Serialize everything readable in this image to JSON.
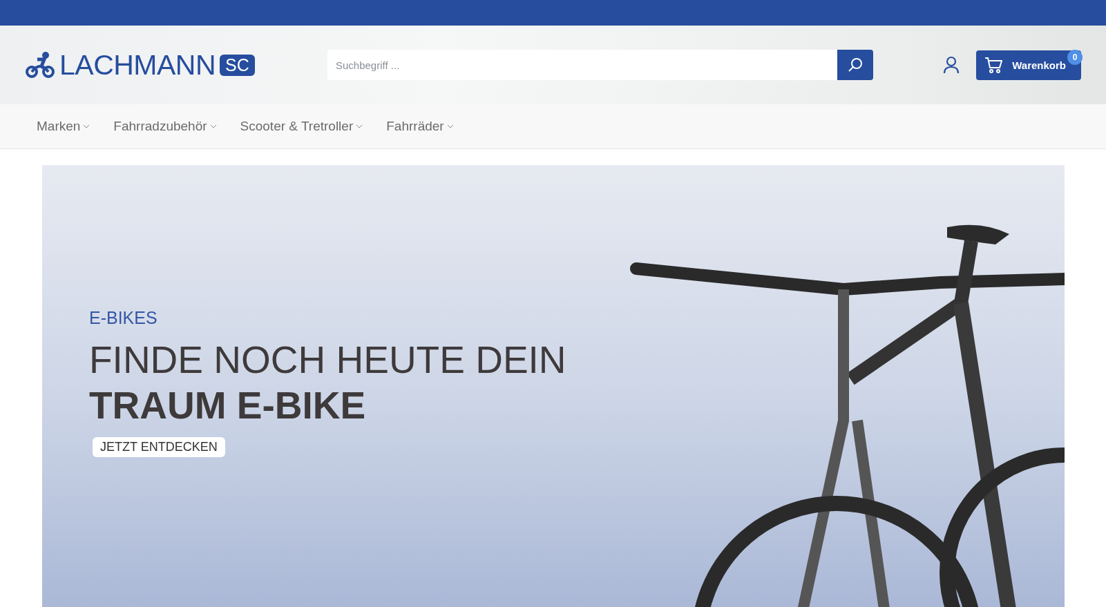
{
  "header": {
    "logo": {
      "name": "LACHMANN",
      "badge": "SC"
    },
    "search": {
      "placeholder": "Suchbegriff ..."
    },
    "cart": {
      "label": "Warenkorb",
      "count": "0"
    }
  },
  "nav": {
    "items": [
      {
        "label": "Marken"
      },
      {
        "label": "Fahrradzubehör"
      },
      {
        "label": "Scooter & Tretroller"
      },
      {
        "label": "Fahrräder"
      }
    ]
  },
  "hero": {
    "kicker": "E-BIKES",
    "headline": "FINDE NOCH HEUTE DEIN",
    "headline_bold": "TRAUM E-BIKE",
    "button": "JETZT ENTDECKEN"
  }
}
